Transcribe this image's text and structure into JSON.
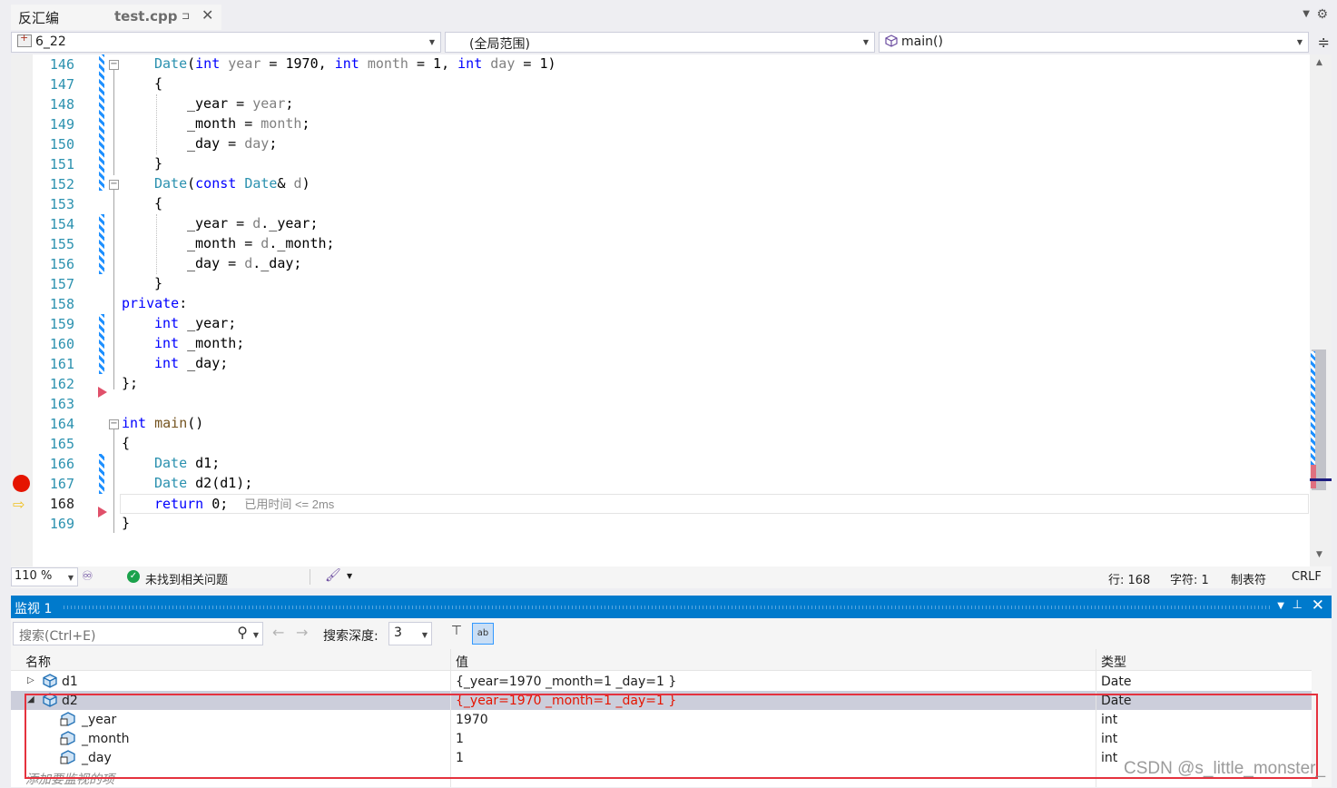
{
  "tabs": {
    "disasm": "反汇编",
    "file": "test.cpp",
    "pin_glyph": "⊐",
    "close_glyph": "✕"
  },
  "navbar": {
    "project": "6_22",
    "scope": "(全局范围)",
    "function": "main()"
  },
  "editor": {
    "lines": [
      {
        "n": "146",
        "html": "<span class=\"ty\">Date</span>(<span class=\"kw\">int</span> <span class=\"pr\">year</span> = 1970, <span class=\"kw\">int</span> <span class=\"pr\">month</span> = 1, <span class=\"kw\">int</span> <span class=\"pr\">day</span> = 1)",
        "indent": 1
      },
      {
        "n": "147",
        "html": "{",
        "indent": 1
      },
      {
        "n": "148",
        "html": "_year = <span class=\"pr\">year</span>;",
        "indent": 2
      },
      {
        "n": "149",
        "html": "_month = <span class=\"pr\">month</span>;",
        "indent": 2
      },
      {
        "n": "150",
        "html": "_day = <span class=\"pr\">day</span>;",
        "indent": 2
      },
      {
        "n": "151",
        "html": "}",
        "indent": 1
      },
      {
        "n": "152",
        "html": "<span class=\"ty\">Date</span>(<span class=\"kw\">const</span> <span class=\"ty\">Date</span>&amp; <span class=\"pr\">d</span>)",
        "indent": 1
      },
      {
        "n": "153",
        "html": "{",
        "indent": 1
      },
      {
        "n": "154",
        "html": "_year = <span class=\"pr\">d</span>._year;",
        "indent": 2
      },
      {
        "n": "155",
        "html": "_month = <span class=\"pr\">d</span>._month;",
        "indent": 2
      },
      {
        "n": "156",
        "html": "_day = <span class=\"pr\">d</span>._day;",
        "indent": 2
      },
      {
        "n": "157",
        "html": "}",
        "indent": 1
      },
      {
        "n": "158",
        "html": "<span class=\"kw\">private</span>:",
        "indent": 0
      },
      {
        "n": "159",
        "html": "<span class=\"kw\">int</span> _year;",
        "indent": 1
      },
      {
        "n": "160",
        "html": "<span class=\"kw\">int</span> _month;",
        "indent": 1
      },
      {
        "n": "161",
        "html": "<span class=\"kw\">int</span> _day;",
        "indent": 1
      },
      {
        "n": "162",
        "html": "};",
        "indent": 0
      },
      {
        "n": "163",
        "html": "",
        "indent": 0
      },
      {
        "n": "164",
        "html": "<span class=\"kw\">int</span> <span class=\"fn\">main</span>()",
        "indent": 0
      },
      {
        "n": "165",
        "html": "{",
        "indent": 0
      },
      {
        "n": "166",
        "html": "<span class=\"ty\">Date</span> d1;",
        "indent": 1
      },
      {
        "n": "167",
        "html": "<span class=\"ty\">Date</span> d2(d1);",
        "indent": 1
      },
      {
        "n": "168",
        "html": "<span class=\"kw\">return</span> 0;  <span class=\"hint\">已用时间 &lt;= 2ms</span>",
        "indent": 1
      },
      {
        "n": "169",
        "html": "}",
        "indent": 0
      }
    ],
    "current_line": "168",
    "breakpoint_line": "167"
  },
  "status": {
    "zoom": "110 %",
    "issues": "未找到相关问题",
    "line": "行: 168",
    "char": "字符: 1",
    "tabs": "制表符",
    "eol": "CRLF"
  },
  "watch": {
    "title": "监视 1",
    "search_placeholder": "搜索(Ctrl+E)",
    "depth_label": "搜索深度:",
    "depth_value": "3",
    "columns": {
      "name": "名称",
      "value": "值",
      "type": "类型"
    },
    "rows": [
      {
        "name": "d1",
        "value": "{_year=1970 _month=1 _day=1 }",
        "type": "Date"
      },
      {
        "name": "d2",
        "value": "{_year=1970 _month=1 _day=1 }",
        "type": "Date"
      },
      {
        "name": "_year",
        "value": "1970",
        "type": "int"
      },
      {
        "name": "_month",
        "value": "1",
        "type": "int"
      },
      {
        "name": "_day",
        "value": "1",
        "type": "int"
      }
    ],
    "add_placeholder": "添加要监视的项"
  },
  "watermark": "CSDN @s_little_monster_"
}
